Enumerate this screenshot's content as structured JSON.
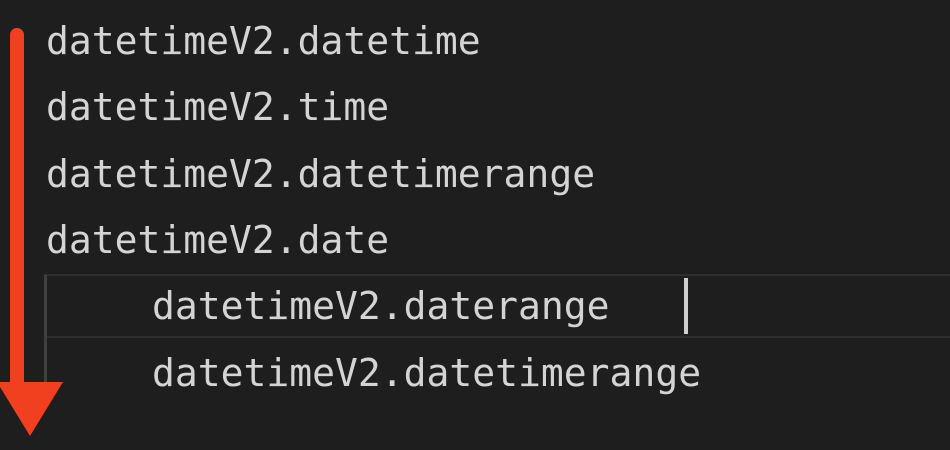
{
  "editor": {
    "lines": [
      {
        "text": "datetimeV2.datetime"
      },
      {
        "text": "datetimeV2.time"
      },
      {
        "text": "datetimeV2.datetimerange"
      },
      {
        "text": "datetimeV2.date"
      },
      {
        "text": "datetimeV2.daterange"
      },
      {
        "text": "datetimeV2.datetimerange"
      }
    ],
    "current_line": 5
  },
  "colors": {
    "background": "#1e1e1e",
    "text": "#d4d4d4",
    "annotation_arrow": "#f0401f"
  },
  "icons": {
    "annotation": "down-arrow-icon"
  }
}
